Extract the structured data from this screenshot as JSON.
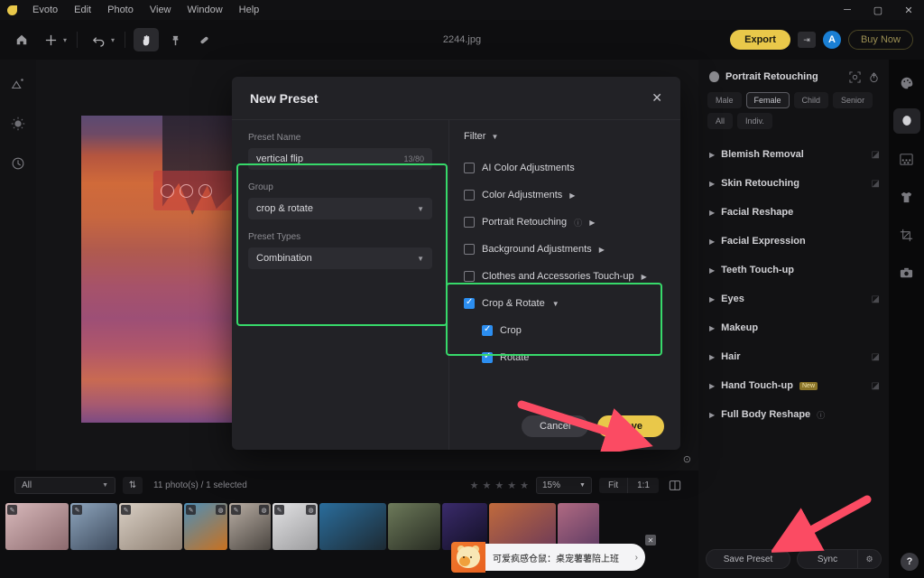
{
  "titlebar": {
    "app_name": "Evoto",
    "menus": [
      "Edit",
      "Photo",
      "View",
      "Window",
      "Help"
    ],
    "window_controls": {
      "minimize": "─",
      "maximize": "▢",
      "close": "✕"
    }
  },
  "toolbar": {
    "document_title": "2244.jpg",
    "icons": [
      "home-icon",
      "plus-icon",
      "undo-icon",
      "hand-icon",
      "clone-stamp-icon",
      "healing-brush-icon"
    ],
    "export_label": "Export",
    "export_icon": "export-to-icon",
    "avatar_initial": "A",
    "buy_label": "Buy Now"
  },
  "left_rail": {
    "icons": [
      "ai-image-icon",
      "brightness-icon",
      "history-icon"
    ]
  },
  "canvas": {
    "zoom_badge": "⊙"
  },
  "modal": {
    "title": "New Preset",
    "close_icon": "close-icon",
    "preset_name_label": "Preset Name",
    "preset_name_value": "vertical flip",
    "preset_name_count": "13/80",
    "group_label": "Group",
    "group_value": "crop & rotate",
    "preset_types_label": "Preset Types",
    "preset_types_value": "Combination",
    "filter_label": "Filter",
    "filter_items": [
      {
        "label": "AI Color Adjustments",
        "checked": false,
        "expandable": false,
        "info": false
      },
      {
        "label": "Color Adjustments",
        "checked": false,
        "expandable": true,
        "info": false
      },
      {
        "label": "Portrait Retouching",
        "checked": false,
        "expandable": true,
        "info": true
      },
      {
        "label": "Background Adjustments",
        "checked": false,
        "expandable": true,
        "info": false
      },
      {
        "label": "Clothes and Accessories Touch-up",
        "checked": false,
        "expandable": true,
        "info": false
      },
      {
        "label": "Crop & Rotate",
        "checked": true,
        "expandable": true,
        "expanded": true,
        "info": false
      }
    ],
    "sub_items": [
      {
        "label": "Crop",
        "checked": true
      },
      {
        "label": "Rotate",
        "checked": true
      }
    ],
    "cancel_label": "Cancel",
    "save_label": "Save",
    "highlight_color": "#37d96a"
  },
  "right_panel": {
    "title": "Portrait Retouching",
    "head_icons": [
      "face-detect-icon",
      "reset-icon"
    ],
    "pills": [
      {
        "label": "Male",
        "selected": false
      },
      {
        "label": "Female",
        "selected": true
      },
      {
        "label": "Child",
        "selected": false
      },
      {
        "label": "Senior",
        "selected": false
      },
      {
        "label": "All",
        "selected": false
      },
      {
        "label": "Indiv.",
        "selected": false
      }
    ],
    "sections": [
      {
        "label": "Blemish Removal",
        "edit": true,
        "badge": "",
        "info": false
      },
      {
        "label": "Skin Retouching",
        "edit": true,
        "badge": "",
        "info": false
      },
      {
        "label": "Facial Reshape",
        "edit": false,
        "badge": "",
        "info": false
      },
      {
        "label": "Facial Expression",
        "edit": false,
        "badge": "",
        "info": false
      },
      {
        "label": "Teeth Touch-up",
        "edit": false,
        "badge": "",
        "info": false
      },
      {
        "label": "Eyes",
        "edit": true,
        "badge": "",
        "info": false
      },
      {
        "label": "Makeup",
        "edit": false,
        "badge": "",
        "info": false
      },
      {
        "label": "Hair",
        "edit": true,
        "badge": "",
        "info": false
      },
      {
        "label": "Hand Touch-up",
        "edit": true,
        "badge": "New",
        "info": false
      },
      {
        "label": "Full Body Reshape",
        "edit": false,
        "badge": "",
        "info": true
      }
    ],
    "save_preset_label": "Save Preset",
    "sync_label": "Sync",
    "sync_icon": "sync-settings-icon",
    "help_label": "?"
  },
  "far_rail": {
    "icons": [
      {
        "name": "palette-icon",
        "active": false
      },
      {
        "name": "face-retouch-icon",
        "active": true
      },
      {
        "name": "background-icon",
        "active": false
      },
      {
        "name": "clothes-icon",
        "active": false
      },
      {
        "name": "crop-icon",
        "active": false
      },
      {
        "name": "camera-icon",
        "active": false
      }
    ]
  },
  "bottombar": {
    "filter_value": "All",
    "sort_icon": "sort-icon",
    "photo_count": "11 photo(s) / 1 selected",
    "stars": [
      "★",
      "★",
      "★",
      "★",
      "★"
    ],
    "zoom_value": "15%",
    "fit_label": "Fit",
    "one_to_one_label": "1:1",
    "split_icon": "split-view-icon",
    "thumbnails": [
      {
        "name": "thumb-portrait-1",
        "c1": "#d8b9bb",
        "c2": "#8c6a6e"
      },
      {
        "name": "thumb-portrait-2",
        "c1": "#8ea5bd",
        "c2": "#3d4a5c"
      },
      {
        "name": "thumb-portrait-3",
        "c1": "#d9cfc4",
        "c2": "#8d7f72"
      },
      {
        "name": "thumb-portrait-4",
        "c1": "#4d8fb8",
        "c2": "#c9711f"
      },
      {
        "name": "thumb-portrait-5",
        "c1": "#b9aea4",
        "c2": "#4a4540"
      },
      {
        "name": "thumb-hand",
        "c1": "#e2e2e4",
        "c2": "#9c9c9e"
      },
      {
        "name": "thumb-car",
        "c1": "#2a6d9c",
        "c2": "#1d2a33"
      },
      {
        "name": "thumb-scene",
        "c1": "#6d7a5a",
        "c2": "#272b22"
      },
      {
        "name": "thumb-night",
        "c1": "#3a2b6b",
        "c2": "#120f24"
      },
      {
        "name": "thumb-sunset",
        "c1": "#c06a3c",
        "c2": "#6d3a58"
      },
      {
        "name": "thumb-sunset-2",
        "c1": "#b06a82",
        "c2": "#5d3a62"
      }
    ]
  },
  "toast": {
    "message": "可爱疯感仓鼠：桌宠薯薯陪上班",
    "chevron": "›",
    "close_icon": "close-icon",
    "thumb_icon": "hamster-icon"
  }
}
